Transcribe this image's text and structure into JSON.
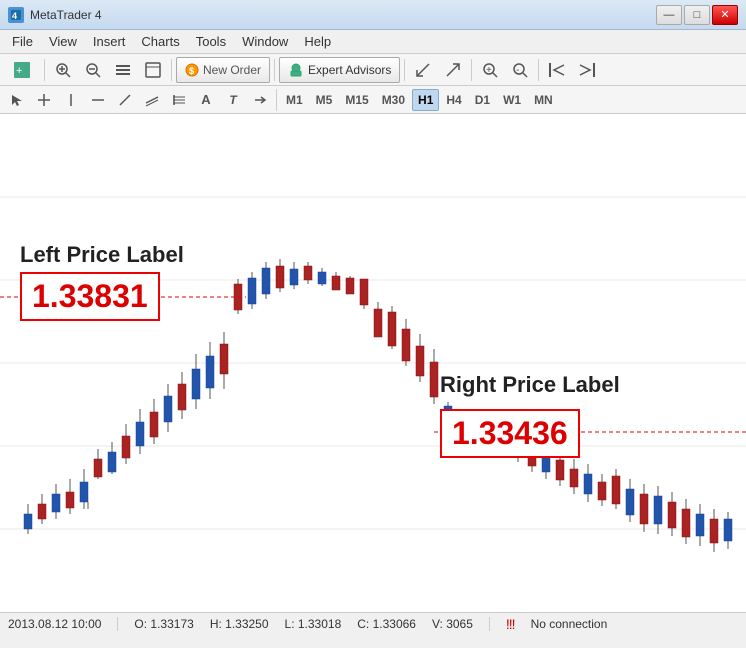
{
  "titleBar": {
    "title": "MetaTrader 4",
    "minimize": "—",
    "maximize": "□",
    "close": "✕"
  },
  "menuBar": {
    "items": [
      "File",
      "View",
      "Insert",
      "Charts",
      "Tools",
      "Window",
      "Help"
    ]
  },
  "toolbar1": {
    "newOrder": "New Order",
    "expertAdvisors": "Expert Advisors"
  },
  "toolbar2": {
    "timeframes": [
      "M1",
      "M5",
      "M15",
      "M30",
      "H1",
      "H4",
      "D1",
      "W1",
      "MN"
    ],
    "activeTimeframe": "H1"
  },
  "chart": {
    "leftPriceLabel": "Left Price Label",
    "leftPriceValue": "1.33831",
    "rightPriceLabel": "Right Price Label",
    "rightPriceValue": "1.33436"
  },
  "statusBar": {
    "datetime": "2013.08.12 10:00",
    "open": "O: 1.33173",
    "high": "H: 1.33250",
    "low": "L: 1.33018",
    "close": "C: 1.33066",
    "volume": "V: 3065",
    "connection": "No connection"
  }
}
